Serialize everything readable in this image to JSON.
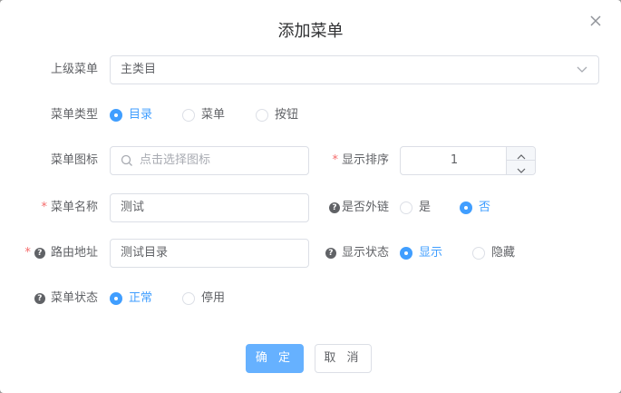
{
  "dialog": {
    "title": "添加菜单",
    "close_icon": "close-icon"
  },
  "form": {
    "parent_menu": {
      "label": "上级菜单",
      "value": "主类目"
    },
    "menu_type": {
      "label": "菜单类型",
      "options": [
        "目录",
        "菜单",
        "按钮"
      ],
      "selected": "目录"
    },
    "menu_icon": {
      "label": "菜单图标",
      "placeholder": "点击选择图标"
    },
    "display_order": {
      "label": "显示排序",
      "value": "1"
    },
    "menu_name": {
      "label": "菜单名称",
      "value": "测试"
    },
    "is_external": {
      "label": "是否外链",
      "options": [
        "是",
        "否"
      ],
      "selected": "否"
    },
    "route_path": {
      "label": "路由地址",
      "value": "测试目录"
    },
    "visibility": {
      "label": "显示状态",
      "options": [
        "显示",
        "隐藏"
      ],
      "selected": "显示"
    },
    "menu_status": {
      "label": "菜单状态",
      "options": [
        "正常",
        "停用"
      ],
      "selected": "正常"
    }
  },
  "footer": {
    "confirm": "确 定",
    "cancel": "取 消"
  },
  "colors": {
    "primary": "#409eff",
    "confirm_button": "#66b1ff",
    "required": "#f56c6c"
  }
}
